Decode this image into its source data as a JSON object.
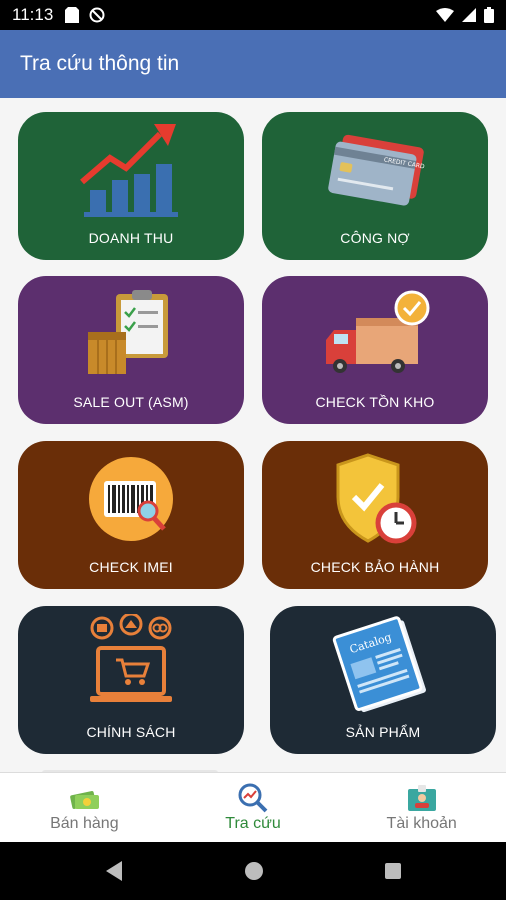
{
  "status_bar": {
    "time": "11:13"
  },
  "app_bar": {
    "title": "Tra cứu thông tin"
  },
  "tiles": [
    {
      "label": "DOANH THU"
    },
    {
      "label": "CÔNG NỢ"
    },
    {
      "label": "SALE OUT (ASM)"
    },
    {
      "label": "CHECK TỒN KHO"
    },
    {
      "label": "CHECK IMEI"
    },
    {
      "label": "CHECK BẢO HÀNH"
    },
    {
      "label": "CHÍNH SÁCH"
    },
    {
      "label": "SẢN PHẨM"
    }
  ],
  "icons": {
    "card_text": "CREDIT CARD",
    "catalog_text": "Catalog"
  },
  "bottom_nav": [
    {
      "label": "Bán hàng",
      "active": false
    },
    {
      "label": "Tra cứu",
      "active": true
    },
    {
      "label": "Tài khoản",
      "active": false
    }
  ],
  "colors": {
    "app_bar": "#4a6fb5",
    "green_tile": "#1f6338",
    "purple_tile": "#5c2f6e",
    "brown_tile": "#6a2e08",
    "navy_tile": "#1e2a35",
    "active_nav": "#2f8a3a"
  }
}
